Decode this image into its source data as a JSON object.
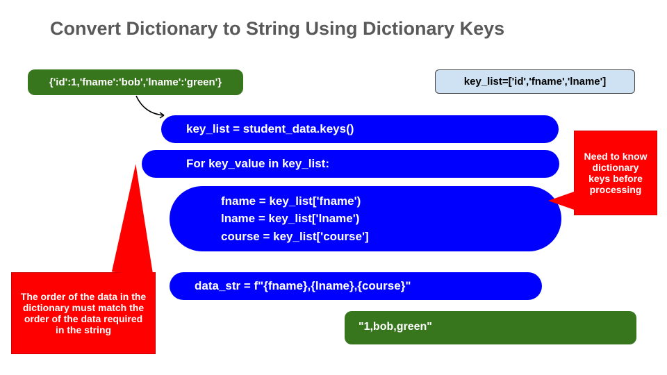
{
  "title": "Convert Dictionary to String Using Dictionary Keys",
  "input_dict": "{'id':1,'fname':'bob','lname':'green'}",
  "key_list_def": "key_list=['id','fname','lname']",
  "code": {
    "line1": "key_list = student_data.keys()",
    "line2": "For key_value in key_list:",
    "line3a": "fname = key_list['fname')",
    "line3b": "lname = key_list['lname')",
    "line3c": "course = key_list['course']",
    "line4": "data_str = f\"{fname},{lname},{course}\""
  },
  "output_str": "\"1,bob,green\"",
  "callouts": {
    "left": "The order of the data in the dictionary must match the order of the data required in the string",
    "right": "Need to know dictionary keys before processing"
  }
}
